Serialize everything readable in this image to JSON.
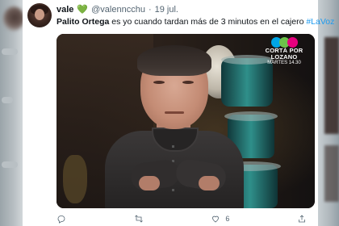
{
  "tweet": {
    "author_name": "vale",
    "handle": "@valenncchu",
    "separator": "·",
    "date": "19 jul.",
    "text_bold": "Palito Ortega",
    "text_plain": " es yo cuando tardan más de 3 minutos en el cajero ",
    "hashtag": "#LaVoz",
    "like_count": "6"
  },
  "media": {
    "logo_line1": "CORTÁ POR",
    "logo_line2": "LOZANO",
    "logo_schedule": "MARTES 14.30",
    "logo_colors": [
      "#00a6e6",
      "#6cc24a",
      "#e6007e"
    ]
  },
  "icons": {
    "reply": "reply-icon",
    "retweet": "retweet-icon",
    "like": "heart-icon",
    "share": "share-icon",
    "heart_badge": "green-heart-icon"
  },
  "colors": {
    "hashtag": "#1d9bf0",
    "heart": "#3dbb4a",
    "muted": "#536471"
  }
}
